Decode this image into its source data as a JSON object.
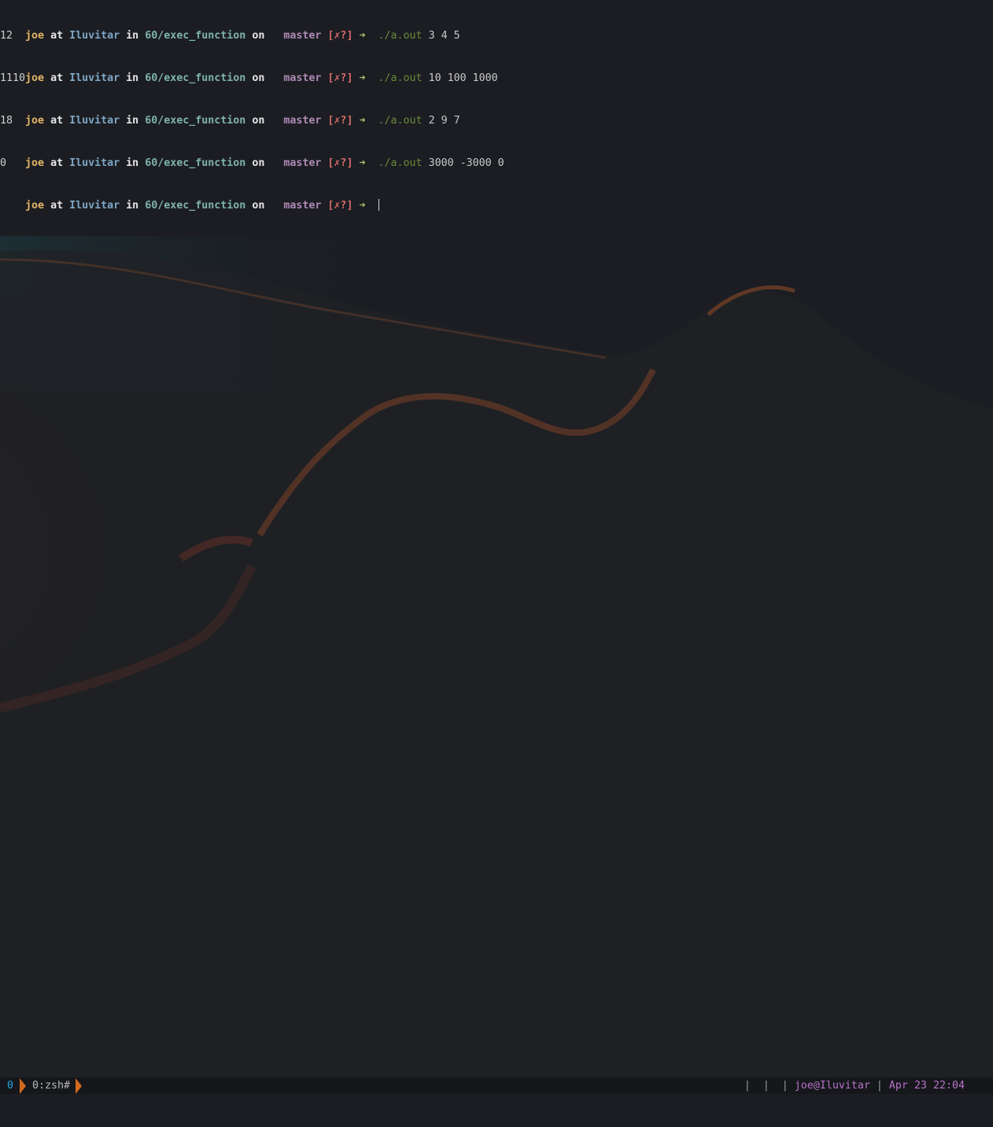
{
  "prompt": {
    "user": "joe",
    "at": "at",
    "host": "Iluvitar",
    "in": "in",
    "path": "60/exec_function",
    "on": "on",
    "branch_icon": "",
    "branch": "master",
    "git_status": "[✗?]",
    "arrow": "➜"
  },
  "commands": [
    {
      "cmd": "./a.out",
      "args": "3 4 5",
      "output": "12"
    },
    {
      "cmd": "./a.out",
      "args": "10 100 1000",
      "output": "1110"
    },
    {
      "cmd": "./a.out",
      "args": "2 9 7",
      "output": "18"
    },
    {
      "cmd": "./a.out",
      "args": "3000 -3000 0",
      "output": "0"
    }
  ],
  "statusbar": {
    "session": "0",
    "window": "0:zsh#",
    "separators": "|  |  |",
    "userhost": "joe@Iluvitar",
    "divider": "|",
    "datetime": "Apr 23 22:04"
  },
  "colors": {
    "background": "#1b1d22",
    "user": "#e3b565",
    "host": "#7ea6c5",
    "path": "#7fb4a7",
    "branch": "#b08ab7",
    "status": "#d56b6b",
    "arrow": "#a7c06b",
    "command": "#6a8a3a",
    "tmux_accent": "#d2691e",
    "tmux_session": "#1ea0e0",
    "tmux_userhost": "#b873c8"
  }
}
